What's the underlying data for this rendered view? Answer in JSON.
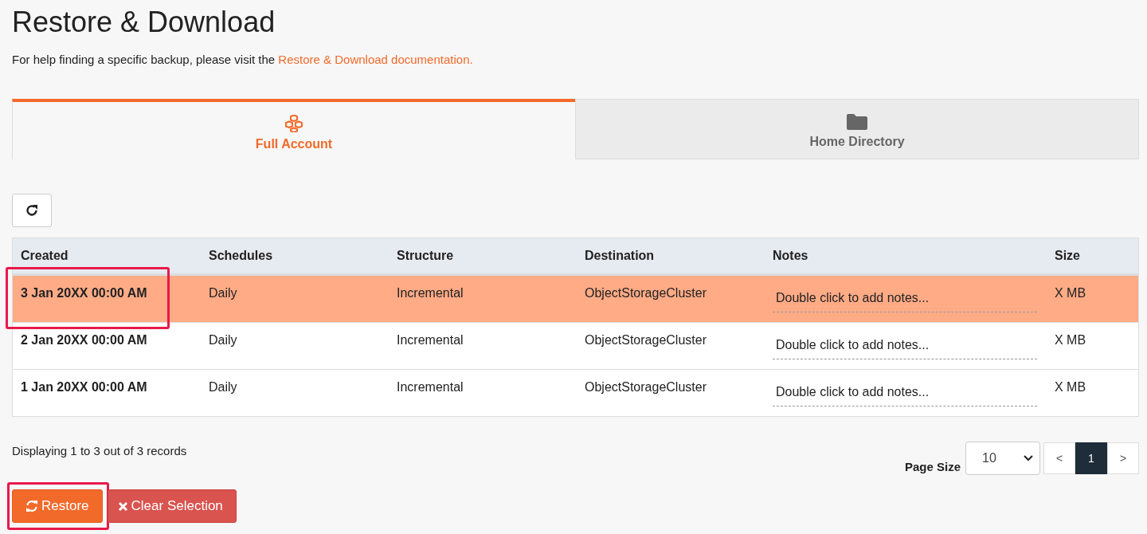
{
  "title": "Restore & Download",
  "help": {
    "text": "For help finding a specific backup, please visit the ",
    "link": "Restore & Download documentation."
  },
  "tabs": [
    {
      "label": "Full Account",
      "kind": "account",
      "selected": true
    },
    {
      "label": "Home Directory",
      "kind": "directory",
      "selected": false
    }
  ],
  "table": {
    "columns": [
      "Created",
      "Schedules",
      "Structure",
      "Destination",
      "Notes",
      "Size"
    ],
    "rows": [
      {
        "created": "3 Jan 20XX 00:00 AM",
        "schedule": "Daily",
        "structure": "Incremental",
        "destination": "ObjectStorageCluster",
        "notes": "Double click to add notes...",
        "size": "X MB",
        "selected": true,
        "annotated": true
      },
      {
        "created": "2 Jan 20XX 00:00 AM",
        "schedule": "Daily",
        "structure": "Incremental",
        "destination": "ObjectStorageCluster",
        "notes": "Double click to add notes...",
        "size": "X MB",
        "selected": false,
        "annotated": false
      },
      {
        "created": "1 Jan 20XX 00:00 AM",
        "schedule": "Daily",
        "structure": "Incremental",
        "destination": "ObjectStorageCluster",
        "notes": "Double click to add notes...",
        "size": "X MB",
        "selected": false,
        "annotated": false
      }
    ]
  },
  "records": "Displaying 1 to 3 out of 3 records",
  "page_size": {
    "label": "Page Size",
    "value": "10"
  },
  "pagination": [
    {
      "label": "<",
      "selected": false
    },
    {
      "label": "1",
      "selected": true
    },
    {
      "label": ">",
      "selected": false
    }
  ],
  "buttons": [
    {
      "label": "Restore",
      "kind": "restore",
      "annotated": true
    },
    {
      "label": "Clear Selection",
      "kind": "clear",
      "annotated": false
    }
  ]
}
